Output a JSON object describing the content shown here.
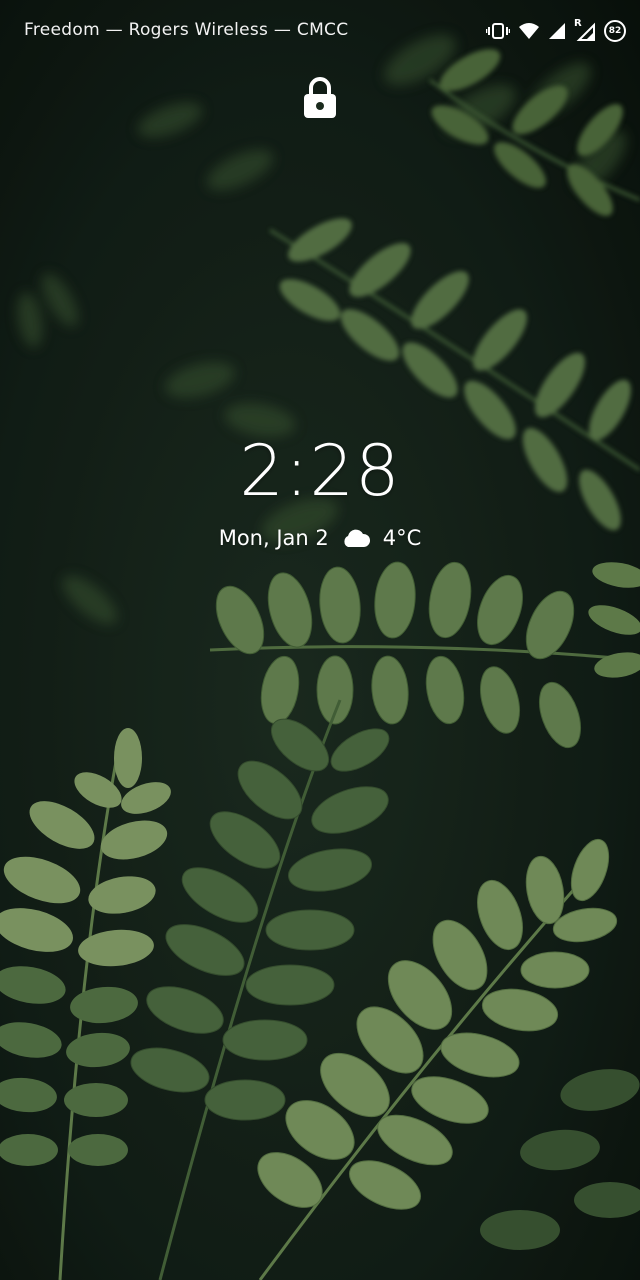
{
  "status_bar": {
    "carriers": "Freedom — Rogers Wireless — CMCC",
    "roaming_indicator": "R",
    "battery_level": "82",
    "icons": [
      "vibrate-icon",
      "wifi-icon",
      "signal-icon",
      "roaming-signal-icon",
      "battery-icon"
    ]
  },
  "lockscreen": {
    "lock_icon": "lock-icon",
    "time": "2:28",
    "date": "Mon, Jan 2",
    "weather_icon": "cloud-icon",
    "temperature": "4°C"
  },
  "colors": {
    "text": "#ffffff",
    "wallpaper_dark": "#0f1a12",
    "leaf_light": "#7e9a65",
    "leaf_mid": "#4d6b42",
    "leaf_dark": "#23372a"
  }
}
